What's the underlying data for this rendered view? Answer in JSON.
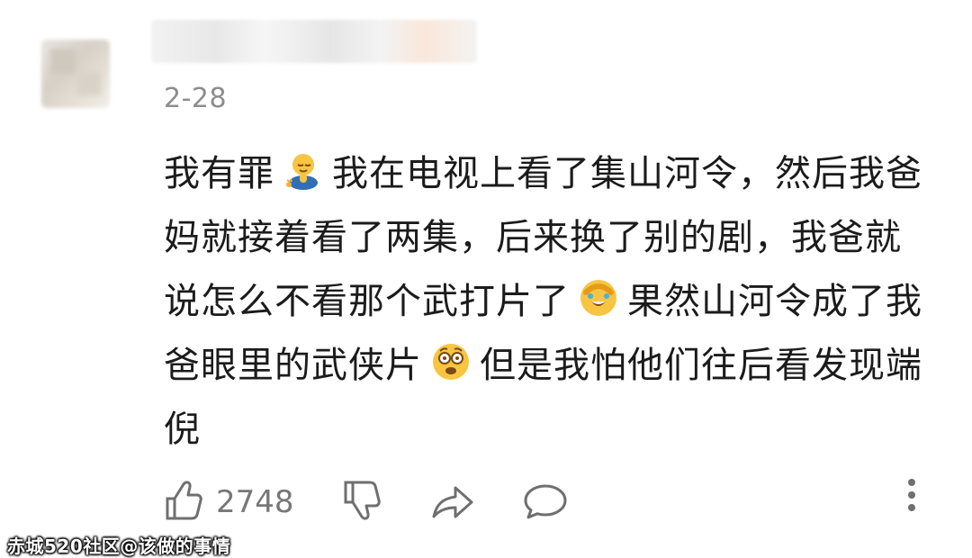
{
  "comment": {
    "date": "2-28",
    "lines": [
      "我有罪",
      "我在电视上看了集山河令，然后我爸妈就接着看了两集，后来换了别的剧，我爸就说怎么不看那个武打片了",
      "果然山河令成了我爸眼里的武侠片",
      "但是我怕他们往后看发现端倪"
    ],
    "emojis": [
      "praying-emoji",
      "facepalm-laugh-emoji",
      "shocked-emoji"
    ]
  },
  "actions": {
    "like_count": "2748",
    "icons": [
      "thumbs-up-icon",
      "thumbs-down-icon",
      "share-icon",
      "comment-icon",
      "more-vertical-icon"
    ]
  },
  "watermark": {
    "text": "赤城520社区@该做的事情"
  },
  "colors": {
    "text": "#1b1b1b",
    "meta": "#8d8d8d",
    "icon": "#6f6f6f"
  }
}
